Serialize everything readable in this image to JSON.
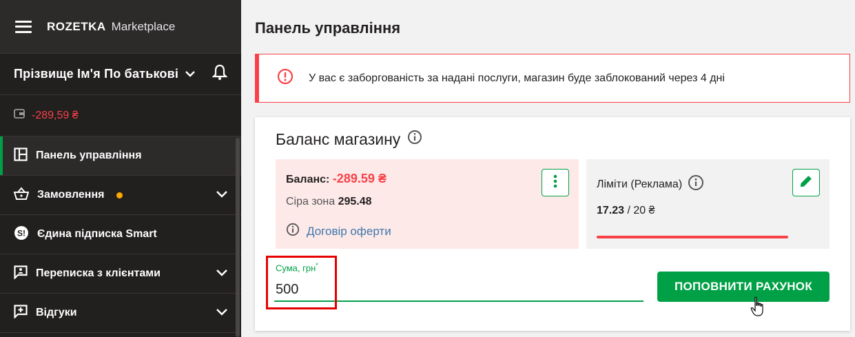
{
  "brand": {
    "name": "ROZETKA",
    "sub": "Marketplace"
  },
  "user": {
    "name": "Прізвище Ім'я По батькові"
  },
  "wallet": {
    "balance": "-289,59 ₴"
  },
  "nav": [
    {
      "label": "Панель управління"
    },
    {
      "label": "Замовлення"
    },
    {
      "label": "Єдина підписка Smart"
    },
    {
      "label": "Переписка з клієнтами"
    },
    {
      "label": "Відгуки"
    }
  ],
  "page": {
    "title": "Панель управління"
  },
  "alert": {
    "text": "У вас є заборгованість за надані послуги, магазин буде заблокований через 4 дні"
  },
  "card": {
    "title": "Баланс магазину",
    "balance_label": "Баланс:",
    "balance_value": "-289.59 ₴",
    "grey_label": "Сіра зона",
    "grey_value": "295.48",
    "offer_link": "Договір оферти",
    "limits_title": "Ліміти (Реклама)",
    "limits_used": "17.23",
    "limits_total": "/ 20 ₴",
    "limits_fraction": 0.8615,
    "sum_label": "Сума, грн",
    "sum_required": "*",
    "sum_value": "500",
    "submit_label": "ПОПОВНИТИ РАХУНОК"
  },
  "colors": {
    "accent": "#00a046",
    "danger": "#f84147",
    "sidebar": "#221f1f",
    "dot": "#ffa900"
  },
  "icons": [
    "hamburger-icon",
    "chevron-down-icon",
    "bell-icon",
    "wallet-icon",
    "dashboard-icon",
    "basket-icon",
    "smart-icon",
    "chat-icon",
    "review-icon",
    "info-icon",
    "more-vertical-icon",
    "pencil-icon",
    "hand-cursor-icon"
  ]
}
